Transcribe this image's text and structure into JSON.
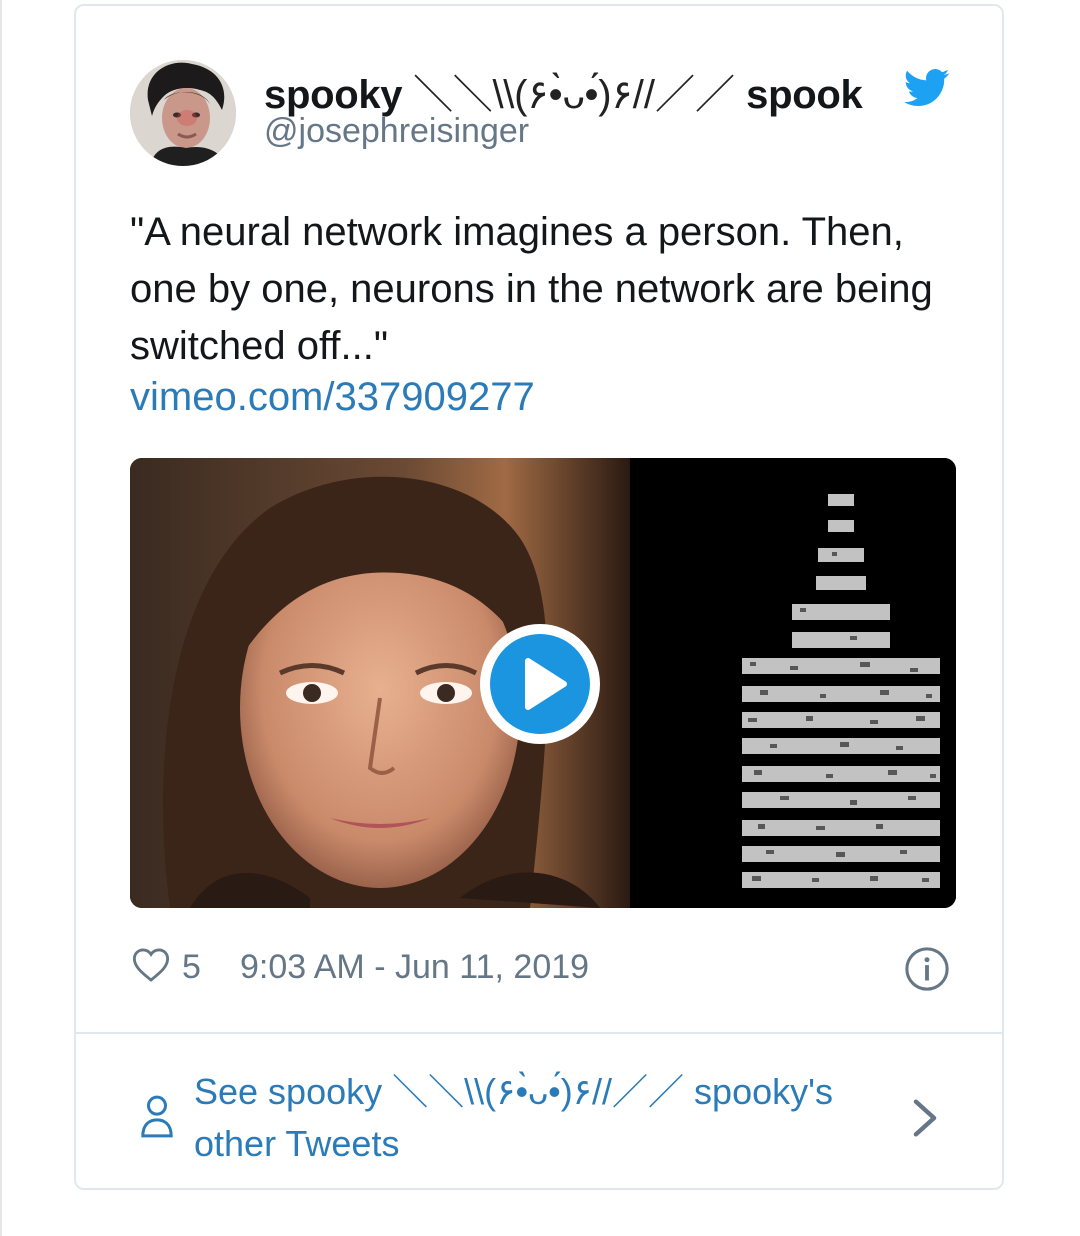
{
  "tweet": {
    "display_name_prefix": "spooky",
    "display_name_kaomoji": "＼＼\\\\(۶•̀ᴗ•́)۶//／／",
    "display_name_suffix": "spook",
    "handle": "@josephreisinger",
    "text": "\"A neural network imagines a person. Then, one by one, neurons in the network are being switched off...\"",
    "link": "vimeo.com/337909277",
    "like_count": "5",
    "timestamp": "9:03 AM - Jun 11, 2019"
  },
  "footer": {
    "see_more_prefix": "See spooky",
    "see_more_kaomoji": "＼＼\\\\(۶•̀ᴗ•́)۶//／／",
    "see_more_suffix": "spooky's",
    "see_more_line2": "other Tweets"
  },
  "colors": {
    "brand_blue": "#1da1f2",
    "link_blue": "#2b7bb9",
    "text_dark": "#14171a",
    "text_gray": "#657786",
    "border": "#e1e8ed"
  },
  "icons": {
    "brand": "twitter-bird-icon",
    "like": "heart-icon",
    "info": "info-icon",
    "play": "play-icon",
    "profile": "person-icon",
    "chevron": "chevron-right-icon"
  }
}
